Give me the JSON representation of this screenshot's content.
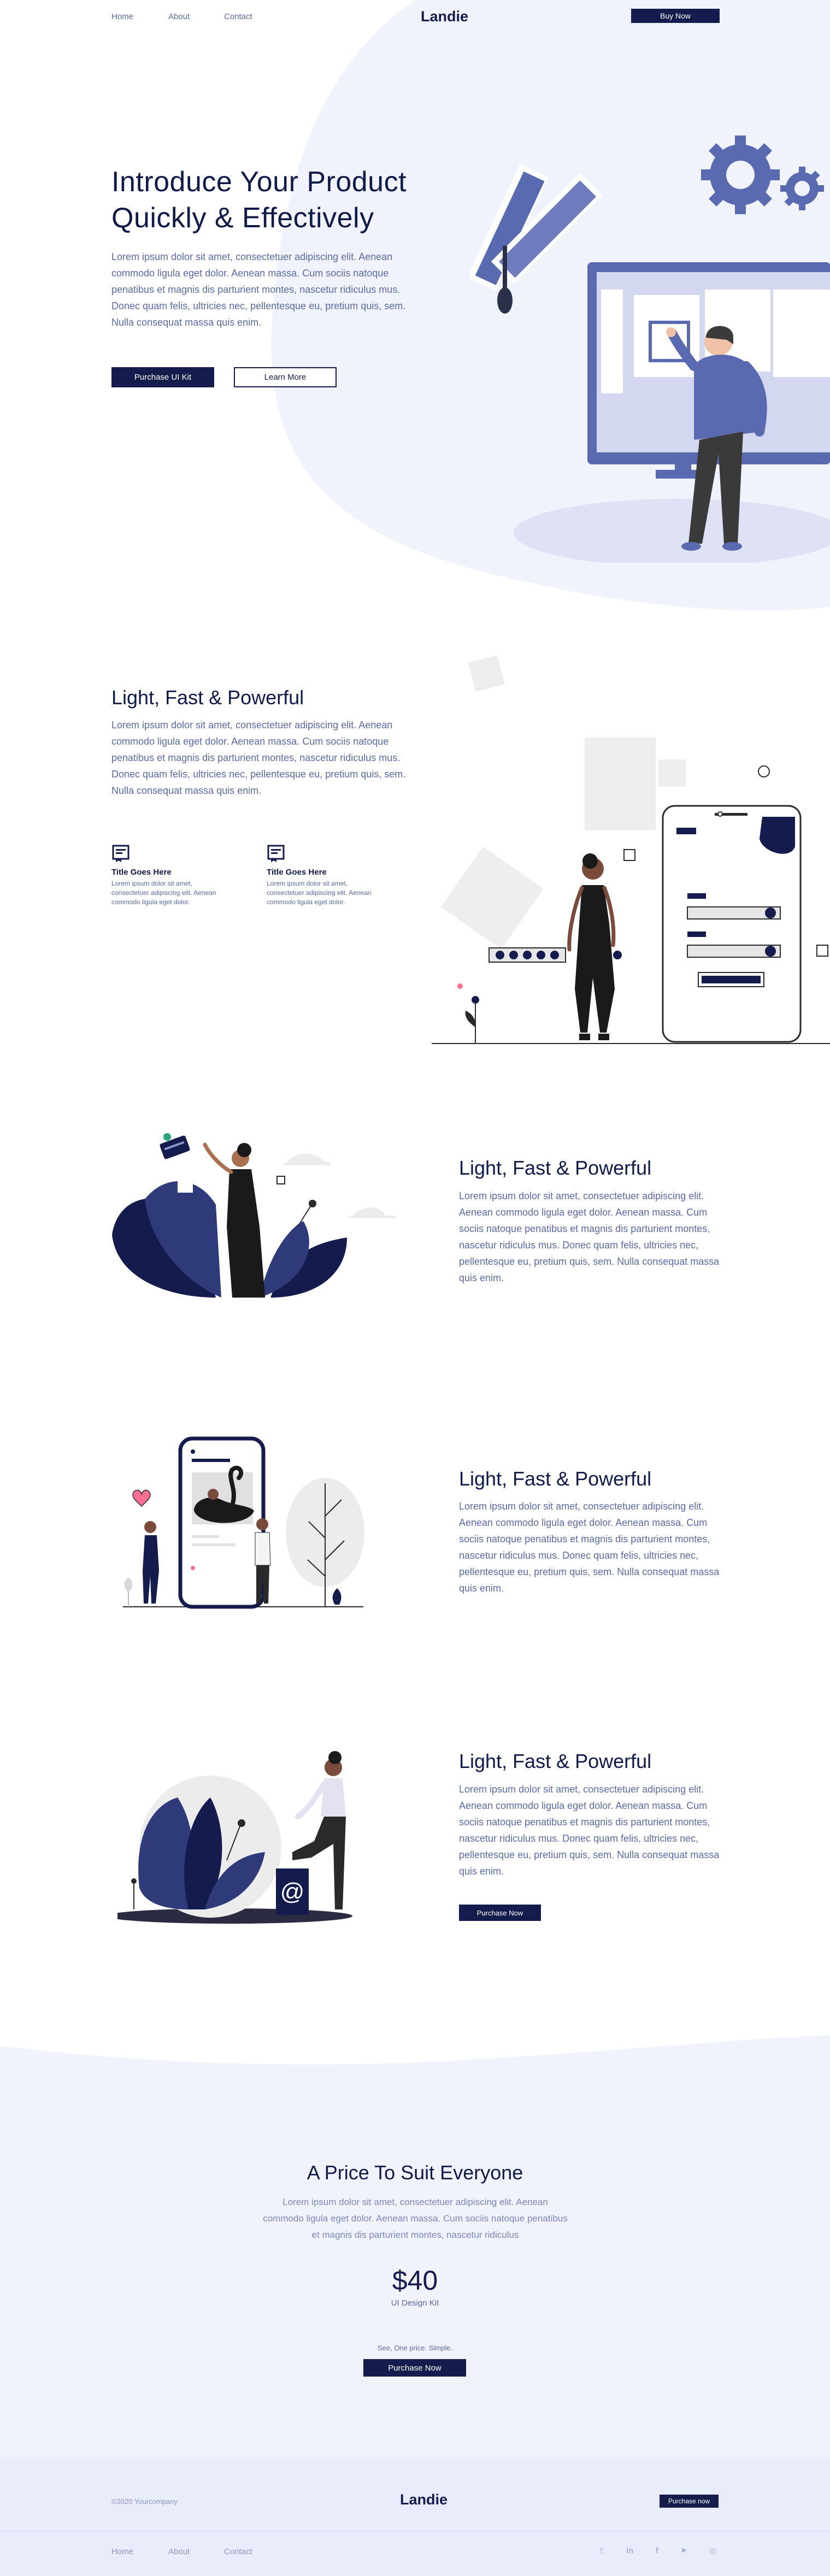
{
  "header": {
    "nav": [
      "Home",
      "About",
      "Contact"
    ],
    "logo": "Landie",
    "buy_label": "Buy Now"
  },
  "hero": {
    "title_line1": "Introduce Your Product",
    "title_line2": "Quickly & Effectively",
    "text": "Lorem ipsum dolor sit amet, consectetuer adipiscing elit. Aenean commodo ligula eget dolor. Aenean massa. Cum sociis natoque penatibus et magnis dis parturient montes, nascetur ridiculus mus. Donec quam felis, ultricies nec, pellentesque eu, pretium quis, sem. Nulla consequat massa quis enim.",
    "primary_label": "Purchase UI Kit",
    "secondary_label": "Learn More"
  },
  "feature1": {
    "title": "Light, Fast & Powerful",
    "text": "Lorem ipsum dolor sit amet, consectetuer adipiscing elit. Aenean commodo ligula eget dolor. Aenean massa. Cum sociis natoque penatibus et magnis dis parturient montes, nascetur ridiculus mus. Donec quam felis, ultricies nec, pellentesque eu, pretium quis, sem. Nulla consequat massa quis enim.",
    "items": [
      {
        "title": "Title Goes Here",
        "text": "Lorem ipsum dolor sit amet, consectetuer adipiscing elit. Aenean commodo ligula eget dolor.",
        "icon": "badge-icon"
      },
      {
        "title": "Title Goes Here",
        "text": "Lorem ipsum dolor sit amet, consectetuer adipiscing elit. Aenean commodo ligula eget dolor.",
        "icon": "badge-icon"
      }
    ]
  },
  "feature2": {
    "title": "Light, Fast & Powerful",
    "text": "Lorem ipsum dolor sit amet, consectetuer adipiscing elit. Aenean commodo ligula eget dolor. Aenean massa. Cum sociis natoque penatibus et magnis dis parturient montes, nascetur ridiculus mus. Donec quam felis, ultricies nec, pellentesque eu, pretium quis, sem. Nulla consequat massa quis enim."
  },
  "feature3": {
    "title": "Light, Fast & Powerful",
    "text": "Lorem ipsum dolor sit amet, consectetuer adipiscing elit. Aenean commodo ligula eget dolor. Aenean massa. Cum sociis natoque penatibus et magnis dis parturient montes, nascetur ridiculus mus. Donec quam felis, ultricies nec, pellentesque eu, pretium quis, sem. Nulla consequat massa quis enim."
  },
  "feature4": {
    "title": "Light, Fast & Powerful",
    "text": "Lorem ipsum dolor sit amet, consectetuer adipiscing elit. Aenean commodo ligula eget dolor. Aenean massa. Cum sociis natoque penatibus et magnis dis parturient montes, nascetur ridiculus mus. Donec quam felis, ultricies nec, pellentesque eu, pretium quis, sem. Nulla consequat massa quis enim.",
    "button_label": "Purchase Now",
    "illustration_glyph": "@"
  },
  "pricing": {
    "title": "A Price To Suit Everyone",
    "text": "Lorem ipsum dolor sit amet, consectetuer adipiscing elit. Aenean commodo ligula eget dolor. Aenean massa. Cum sociis natoque penatibus et magnis dis parturient montes, nascetur ridiculus",
    "price": "$40",
    "product": "UI Design Kit",
    "note": "See, One price. Simple.",
    "button_label": "Purchase Now"
  },
  "footer": {
    "copyright": "©2020 Yourcompany",
    "logo": "Landie",
    "button_label": "Purchase now",
    "nav": [
      "Home",
      "About",
      "Contact"
    ],
    "social_icons": [
      "twitter-icon",
      "linkedin-icon",
      "facebook-icon",
      "youtube-icon",
      "instagram-icon"
    ],
    "social_glyphs": [
      "𝕥",
      "in",
      "f",
      "▶",
      "◎"
    ]
  },
  "colors": {
    "navy": "#141b4d",
    "accent": "#5a6ab0",
    "text_muted": "#5a6aa8",
    "light_bg": "#f1f3fc",
    "footer_bg": "#e9ecfb"
  }
}
